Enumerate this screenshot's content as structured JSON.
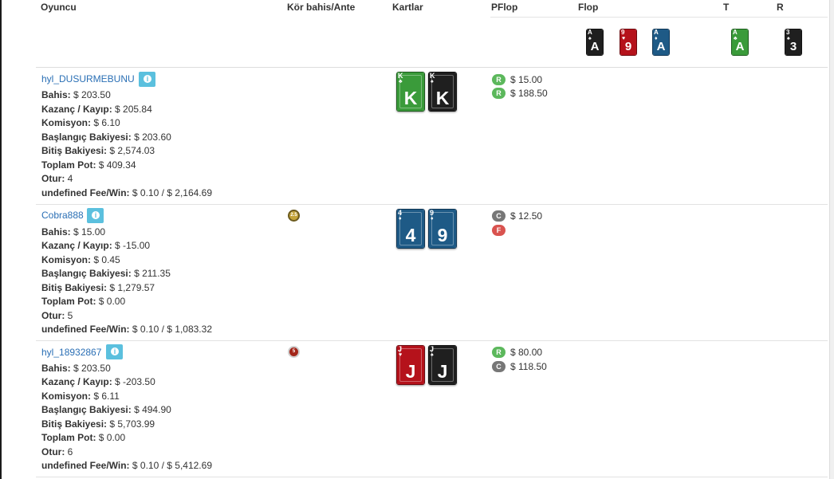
{
  "header": {
    "player": "Oyuncu",
    "blind": "Kör bahis/Ante",
    "cards": "Kartlar",
    "preflop": "PFlop",
    "flop": "Flop",
    "turn": "T",
    "river": "R"
  },
  "board": {
    "flop": [
      {
        "rank": "A",
        "suit": "♠",
        "color": "black"
      },
      {
        "rank": "9",
        "suit": "♥",
        "color": "red"
      },
      {
        "rank": "A",
        "suit": "♦",
        "color": "blue"
      }
    ],
    "turn": {
      "rank": "A",
      "suit": "♣",
      "color": "green"
    },
    "river": {
      "rank": "3",
      "suit": "♠",
      "color": "black"
    }
  },
  "labels": {
    "bet": "Bahis:",
    "winloss": "Kazanç / Kayıp:",
    "commission": "Komisyon:",
    "start_balance": "Başlangıç Bakiyesi:",
    "end_balance": "Bitiş Bakiyesi:",
    "total_pot": "Toplam Pot:",
    "seat": "Otur:",
    "fee_win": "undefined Fee/Win:"
  },
  "players": [
    {
      "name": "hyl_DUSURMEBUNU",
      "bet": "$ 203.50",
      "winloss": "$ 205.84",
      "commission": "$ 6.10",
      "start_balance": "$ 203.60",
      "end_balance": "$ 2,574.03",
      "total_pot": "$ 409.34",
      "seat": "4",
      "fee_win": "$ 0.10 / $ 2,164.69",
      "blind_chip": "",
      "cards": [
        {
          "rank": "K",
          "suit": "♣",
          "color": "green"
        },
        {
          "rank": "K",
          "suit": "♠",
          "color": "black"
        }
      ],
      "actions": [
        {
          "type": "R",
          "amount": "$ 15.00"
        },
        {
          "type": "R",
          "amount": "$ 188.50"
        }
      ]
    },
    {
      "name": "Cobra888",
      "bet": "$ 15.00",
      "winloss": "$ -15.00",
      "commission": "$ 0.45",
      "start_balance": "$ 211.35",
      "end_balance": "$ 1,279.57",
      "total_pot": "$ 0.00",
      "seat": "5",
      "fee_win": "$ 0.10 / $ 1,083.32",
      "blind_chip": "2.5",
      "cards": [
        {
          "rank": "4",
          "suit": "♦",
          "color": "blue"
        },
        {
          "rank": "9",
          "suit": "♦",
          "color": "blue"
        }
      ],
      "actions": [
        {
          "type": "C",
          "amount": "$ 12.50"
        },
        {
          "type": "F",
          "amount": ""
        }
      ]
    },
    {
      "name": "hyl_18932867",
      "bet": "$ 203.50",
      "winloss": "$ -203.50",
      "commission": "$ 6.11",
      "start_balance": "$ 494.90",
      "end_balance": "$ 5,703.99",
      "total_pot": "$ 0.00",
      "seat": "6",
      "fee_win": "$ 0.10 / $ 5,412.69",
      "blind_chip": "5",
      "cards": [
        {
          "rank": "J",
          "suit": "♥",
          "color": "red"
        },
        {
          "rank": "J",
          "suit": "♠",
          "color": "black"
        }
      ],
      "actions": [
        {
          "type": "R",
          "amount": "$ 80.00"
        },
        {
          "type": "C",
          "amount": "$ 118.50"
        }
      ]
    }
  ]
}
